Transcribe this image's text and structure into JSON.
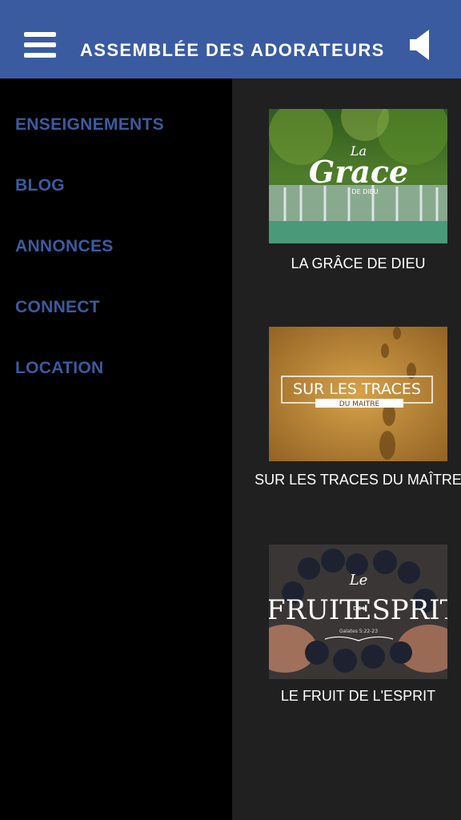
{
  "header": {
    "title": "ASSEMBLÉE DES ADORATEURS",
    "menu_icon": "hamburger-menu-icon",
    "sound_icon": "speaker-icon",
    "background": "#3a5ba0"
  },
  "drawer": {
    "items": [
      {
        "label": "ENSEIGNEMENTS"
      },
      {
        "label": "BLOG"
      },
      {
        "label": "ANNONCES"
      },
      {
        "label": "CONNECT"
      },
      {
        "label": "LOCATION"
      }
    ],
    "text_color": "#3a5ba0"
  },
  "series": [
    {
      "title": "LA GRÂCE DE DIEU",
      "thumb": {
        "line1": "La",
        "line2": "Grace",
        "line3": "DE DIEU"
      }
    },
    {
      "title": "SUR LES TRACES DU MAÎTRE",
      "thumb": {
        "line1": "SUR LES TRACES",
        "line2": "DU MAITRE"
      }
    },
    {
      "title": "LE FRUIT DE L'ESPRIT",
      "thumb": {
        "line1": "Le",
        "line2": "FRUIT",
        "line3": "DE L'",
        "line4": "ESPRIT",
        "line5": "Galates 5:22-23"
      }
    }
  ]
}
